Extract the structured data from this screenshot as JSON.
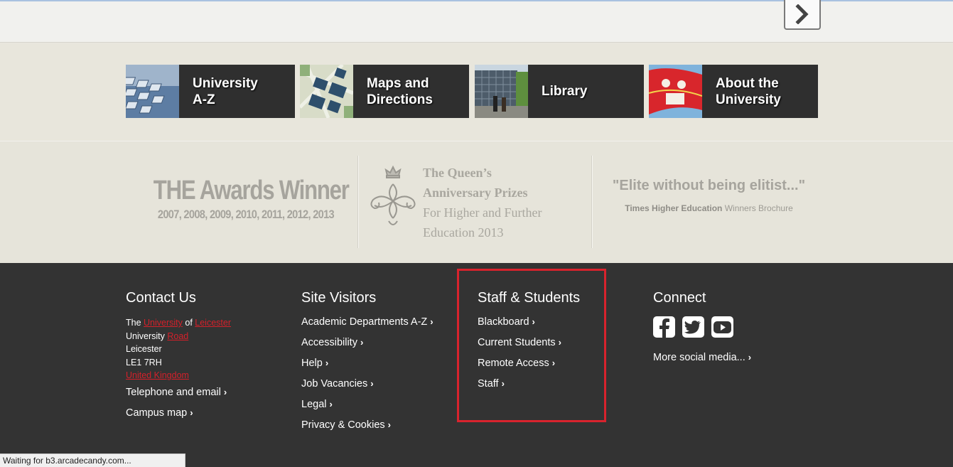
{
  "quick_links": [
    {
      "label": "University\nA-Z"
    },
    {
      "label": "Maps and\nDirections"
    },
    {
      "label": "Library"
    },
    {
      "label": "About the\nUniversity"
    }
  ],
  "awards": {
    "the_title": "THE Awards Winner",
    "the_years": "2007, 2008, 2009, 2010, 2011, 2012, 2013",
    "queens_line1": "The Queen’s",
    "queens_line2": "Anniversary Prizes",
    "queens_line3": "For Higher and Further",
    "queens_line4": "Education 2013",
    "quote": "\"Elite without being elitist...\"",
    "quote_source_bold": "Times Higher Education",
    "quote_source_rest": " Winners Brochure"
  },
  "footer": {
    "contact": {
      "heading": "Contact Us",
      "addr_the": "The ",
      "addr_university": "University",
      "addr_of": " of ",
      "addr_leicester": "Leicester",
      "addr_university2": "University ",
      "addr_road": "Road",
      "addr_city": "Leicester",
      "addr_postcode": "LE1 7RH",
      "addr_country": "United Kingdom",
      "links": [
        "Telephone and email",
        "Campus map"
      ]
    },
    "visitors": {
      "heading": "Site Visitors",
      "links": [
        "Academic Departments A-Z",
        "Accessibility",
        "Help",
        "Job Vacancies",
        "Legal",
        "Privacy & Cookies"
      ]
    },
    "staff": {
      "heading": "Staff & Students",
      "links": [
        "Blackboard",
        "Current Students",
        "Remote Access",
        "Staff"
      ]
    },
    "connect": {
      "heading": "Connect",
      "icons": [
        "facebook-icon",
        "twitter-icon",
        "youtube-icon"
      ],
      "more": "More social media..."
    }
  },
  "status_bar": "Waiting for b3.arcadecandy.com...",
  "colors": {
    "accent_red": "#d9232d",
    "footer_bg": "#333333"
  }
}
